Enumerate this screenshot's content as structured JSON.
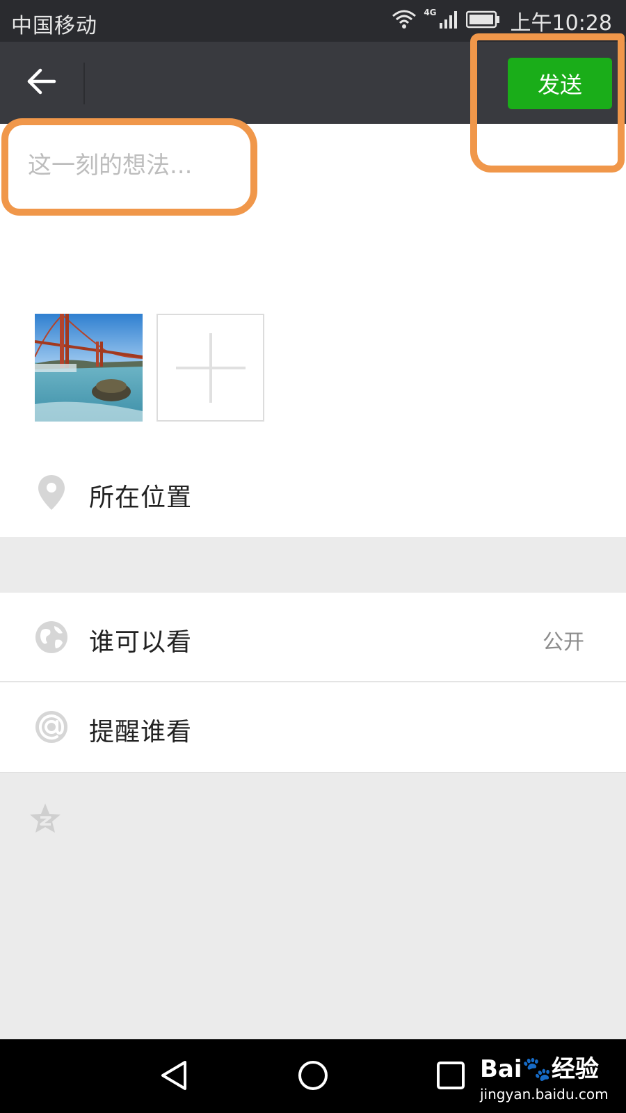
{
  "status_bar": {
    "carrier": "中国移动",
    "network": "4G",
    "time": "上午10:28"
  },
  "nav": {
    "send_label": "发送"
  },
  "compose": {
    "placeholder": "这一刻的想法..."
  },
  "rows": {
    "location_label": "所在位置",
    "visibility_label": "谁可以看",
    "visibility_value": "公开",
    "mention_label": "提醒谁看"
  },
  "watermark": {
    "brand": "Bai🐾经验",
    "site": "jingyan.baidu.com"
  },
  "colors": {
    "send_button": "#1aad19",
    "nav_bar": "#393a3f",
    "status_bar": "#2a2b2f",
    "annotation": "#f0974a"
  },
  "icons": {
    "back": "arrow-left-icon",
    "location": "map-pin-icon",
    "visibility": "globe-icon",
    "mention": "at-sign-icon",
    "qzone": "qzone-star-icon",
    "add_photo": "plus-icon"
  }
}
